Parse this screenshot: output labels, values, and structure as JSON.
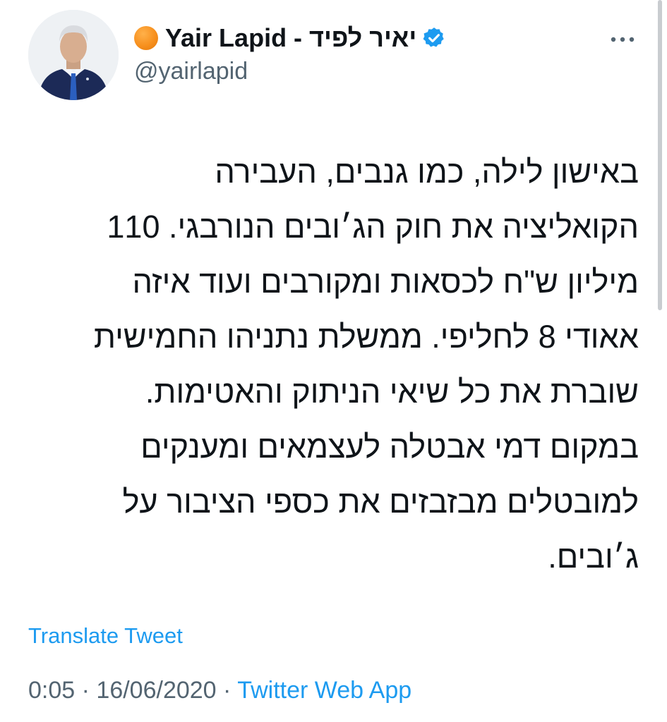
{
  "tweet": {
    "author": {
      "display_name": "Yair Lapid - יאיר לפיד",
      "handle": "@yairlapid",
      "verified": true,
      "emoji": "orange-circle"
    },
    "text_lines": [
      "באישון לילה, כמו גנבים, העבירה",
      "הקואליציה את חוק הג׳ובים הנורבגי. 110",
      "מיליון ש\"ח לכסאות ומקורבים ועוד איזה",
      "אאודי 8 לחליפי. ממשלת נתניהו החמישית",
      "שוברת את כל שיאי הניתוק והאטימות.",
      "במקום דמי אבטלה לעצמאים ומענקים",
      "למובטלים מבזבזים את כספי הציבור על",
      "ג׳ובים."
    ],
    "translate_label": "Translate Tweet",
    "meta": {
      "time": "0:05",
      "separator": "·",
      "date": "16/06/2020",
      "source": "Twitter Web App"
    }
  },
  "colors": {
    "link": "#1d9bf0",
    "secondary_text": "#536471",
    "primary_text": "#0f1419",
    "verified_badge": "#1d9bf0"
  },
  "icons": {
    "more": "more-dots-icon",
    "verified": "verified-badge-icon"
  }
}
